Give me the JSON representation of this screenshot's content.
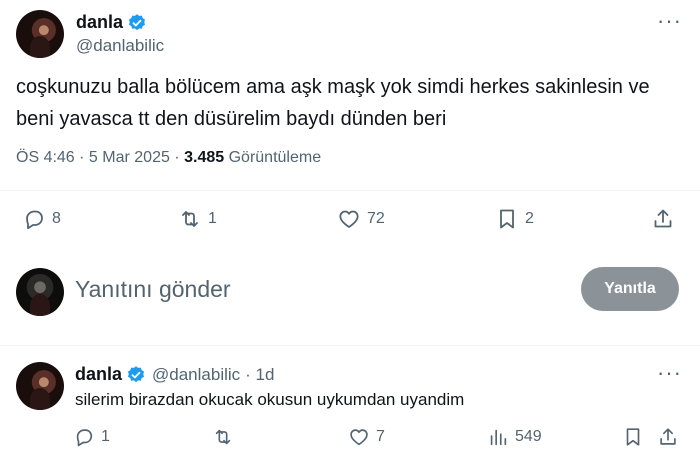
{
  "main_tweet": {
    "name": "danla",
    "handle": "@danlabilic",
    "text_line1": "coşkunuzu balla bölücem ama aşk maşk yok simdi herkes sakinlesin ve",
    "text_line2": "beni yavasca tt den düsürelim baydı dünden beri",
    "time": "ÖS 4:46 · 5 Mar 2025 ·",
    "views_count": "3.485",
    "views_label": "Görüntüleme",
    "more": "···",
    "actions": {
      "replies": "8",
      "retweets": "1",
      "likes": "72",
      "bookmarks": "2"
    }
  },
  "composer": {
    "placeholder": "Yanıtını gönder",
    "button_label": "Yanıtla"
  },
  "reply_tweet": {
    "name": "danla",
    "handle": "@danlabilic",
    "age": "· 1d",
    "more": "···",
    "text": "silerim birazdan okucak okusun uykumdan uyandim",
    "actions": {
      "replies": "1",
      "retweets": "",
      "likes": "7",
      "views": "549"
    }
  },
  "colors": {
    "accent": "#1d9bf0",
    "secondary_text": "#536471",
    "button_bg": "#8b9298"
  }
}
